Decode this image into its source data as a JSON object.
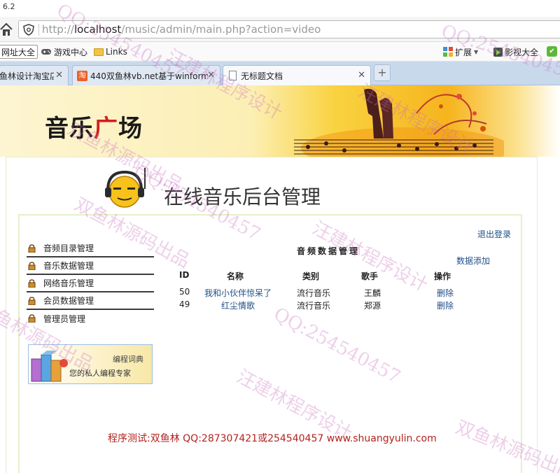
{
  "window": {
    "version_text": "6.2"
  },
  "navbar": {
    "url_prefix": "http://",
    "url_host": "localhost",
    "url_path": "/music/admin/main.php?action=video"
  },
  "bookmarks": {
    "items": [
      {
        "label": "网址大全",
        "icon": "globe-icon"
      },
      {
        "label": "游戏中心",
        "icon": "gamepad-icon"
      },
      {
        "label": "Links",
        "icon": "folder-icon"
      }
    ],
    "extensions_label": "扩展",
    "video_label": "影视大全"
  },
  "tabs": [
    {
      "label": "鱼林设计淘宝店",
      "active": false
    },
    {
      "label": "440双鱼林vb.net基于winform",
      "icon_text": "淘",
      "active": false
    },
    {
      "label": "无标题文档",
      "active": true
    }
  ],
  "banner": {
    "logo_part1": "音乐",
    "logo_part2": "广",
    "logo_part3": "场"
  },
  "header": {
    "title": "在线音乐后台管理"
  },
  "sidebar": {
    "items": [
      {
        "label": "音频目录管理"
      },
      {
        "label": "音乐数据管理"
      },
      {
        "label": "网络音乐管理"
      },
      {
        "label": "会员数据管理"
      },
      {
        "label": "管理员管理"
      }
    ]
  },
  "ad": {
    "title": "编程词典",
    "subtitle": "您的私人编程专家"
  },
  "main": {
    "logout": "退出登录",
    "title": "音频数据管理",
    "add_link": "数据添加",
    "columns": [
      "ID",
      "名称",
      "类别",
      "歌手",
      "操作"
    ],
    "rows": [
      {
        "id": "50",
        "name": "我和小伙伴惊呆了",
        "category": "流行音乐",
        "singer": "王麟",
        "action": "删除"
      },
      {
        "id": "49",
        "name": "红尘情歌",
        "category": "流行音乐",
        "singer": "郑源",
        "action": "删除"
      }
    ]
  },
  "footer": {
    "text": "程序测试:双鱼林 QQ:287307421或254540457 www.shuangyulin.com"
  },
  "watermark": {
    "qq": "QQ:254540457",
    "name_a": "汪建林程序设计",
    "name_b": "双鱼林源码出品"
  }
}
